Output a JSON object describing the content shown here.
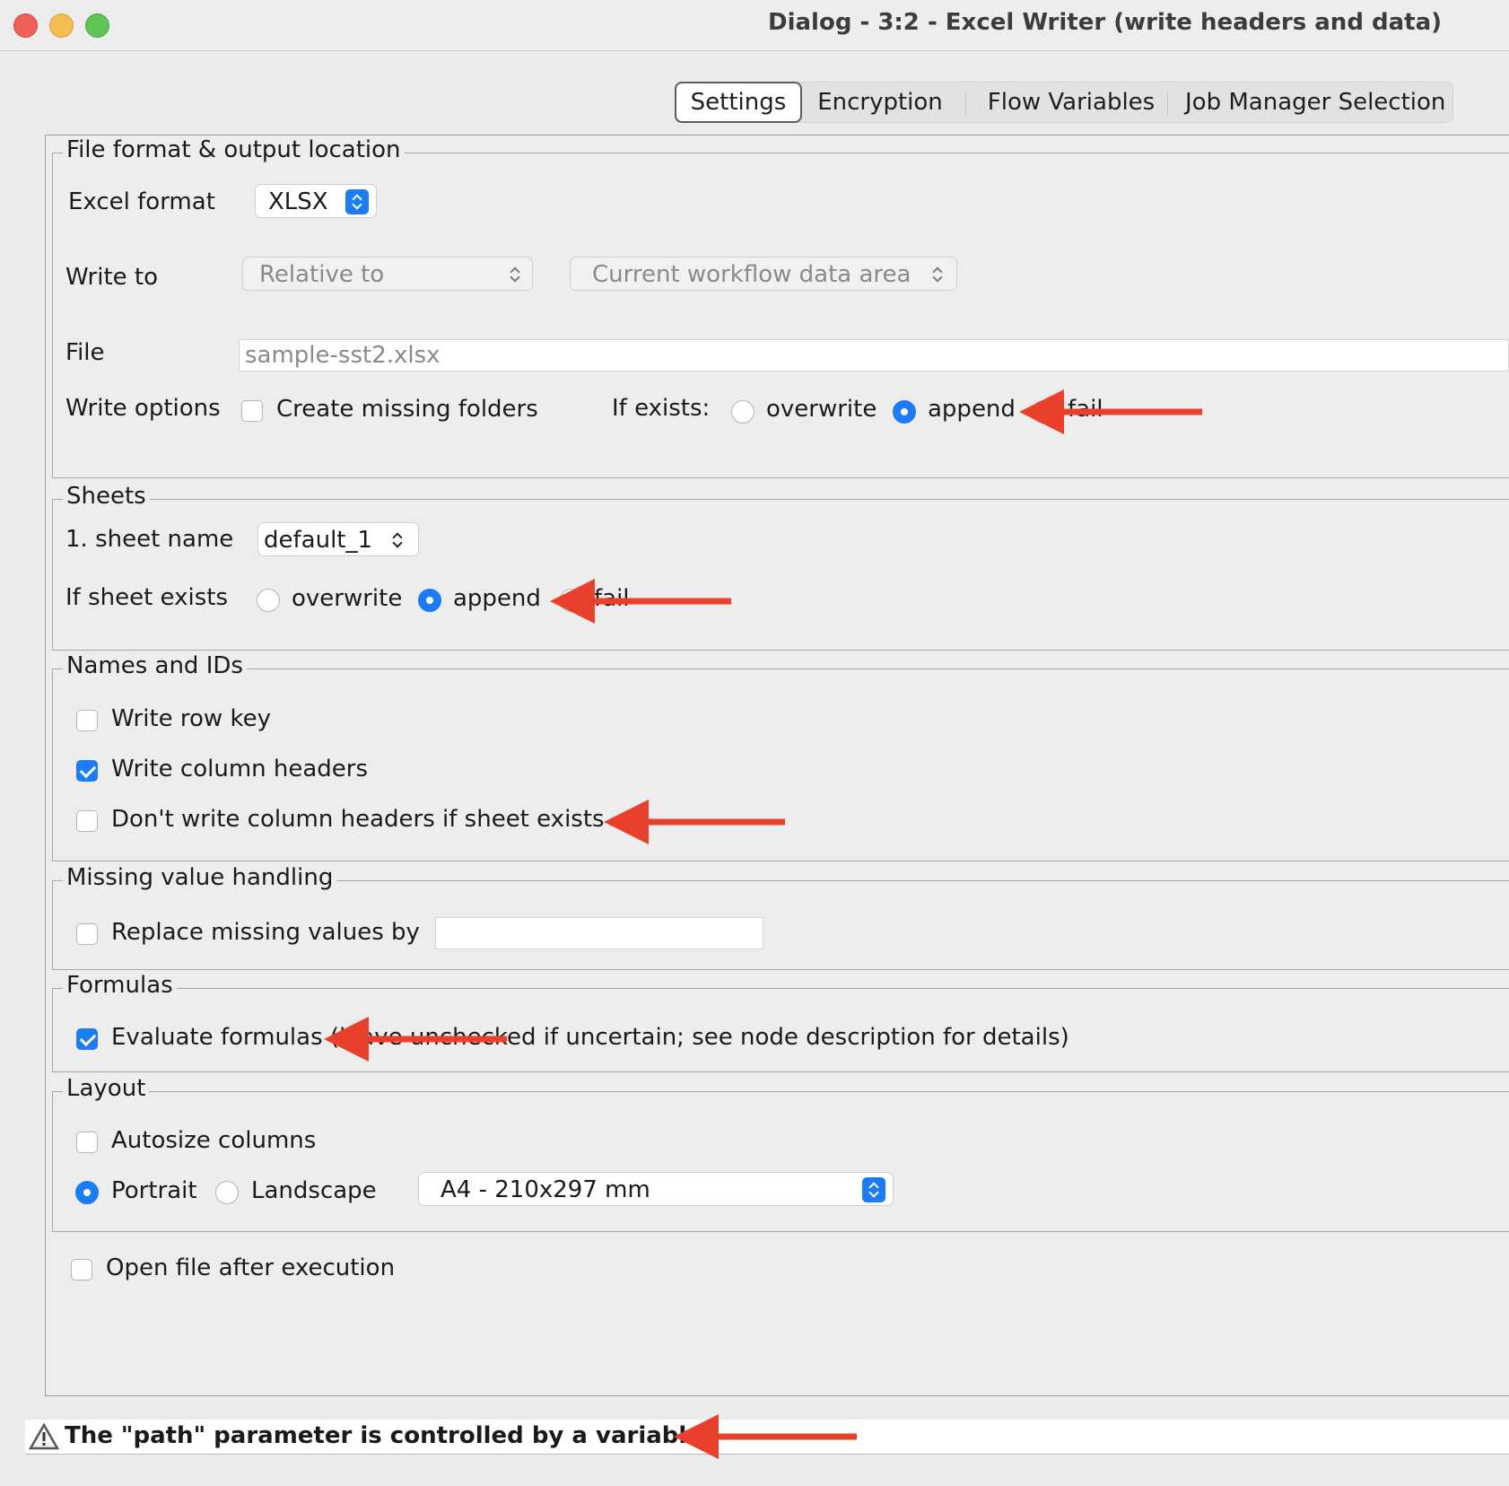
{
  "window": {
    "title": "Dialog - 3:2 - Excel Writer (write headers and data)"
  },
  "tabs": [
    {
      "label": "Settings",
      "active": true
    },
    {
      "label": "Encryption",
      "active": false
    },
    {
      "label": "Flow Variables",
      "active": false
    },
    {
      "label": "Job Manager Selection",
      "active": false
    }
  ],
  "file_format": {
    "group_title": "File format & output location",
    "excel_format_label": "Excel format",
    "excel_format_value": "XLSX",
    "write_to_label": "Write to",
    "write_to_mode": "Relative to",
    "write_to_location": "Current workflow data area",
    "file_label": "File",
    "file_value": "sample-sst2.xlsx",
    "write_options_label": "Write options",
    "create_missing_folders": {
      "label": "Create missing folders",
      "checked": false
    },
    "if_exists_label": "If exists:",
    "if_exists_options": [
      {
        "label": "overwrite",
        "selected": false
      },
      {
        "label": "append",
        "selected": true
      },
      {
        "label": "fail",
        "selected": false
      }
    ]
  },
  "sheets": {
    "group_title": "Sheets",
    "sheet_name_label": "1. sheet name",
    "sheet_name_value": "default_1",
    "if_sheet_exists_label": "If sheet exists",
    "if_sheet_exists_options": [
      {
        "label": "overwrite",
        "selected": false
      },
      {
        "label": "append",
        "selected": true
      },
      {
        "label": "fail",
        "selected": false
      }
    ]
  },
  "names_ids": {
    "group_title": "Names and IDs",
    "write_row_key": {
      "label": "Write row key",
      "checked": false
    },
    "write_column_headers": {
      "label": "Write column headers",
      "checked": true
    },
    "dont_write_headers": {
      "label": "Don't write column headers if sheet exists",
      "checked": false
    }
  },
  "missing_values": {
    "group_title": "Missing value handling",
    "replace_missing": {
      "label": "Replace missing values by",
      "checked": false
    },
    "replacement_value": ""
  },
  "formulas": {
    "group_title": "Formulas",
    "evaluate_formulas": {
      "label": "Evaluate formulas (leave unchecked if uncertain; see node description for details)",
      "checked": true
    }
  },
  "layout": {
    "group_title": "Layout",
    "autosize_columns": {
      "label": "Autosize columns",
      "checked": false
    },
    "orientation": [
      {
        "label": "Portrait",
        "selected": true
      },
      {
        "label": "Landscape",
        "selected": false
      }
    ],
    "paper_size": "A4 - 210x297 mm"
  },
  "open_after_execution": {
    "label": "Open file after execution",
    "checked": false
  },
  "warning": {
    "icon": "warning-triangle-icon",
    "text": "The \"path\" parameter is controlled by a variable."
  },
  "colors": {
    "accent": "#1b7cf5",
    "annotation_arrow": "#e8402a"
  }
}
